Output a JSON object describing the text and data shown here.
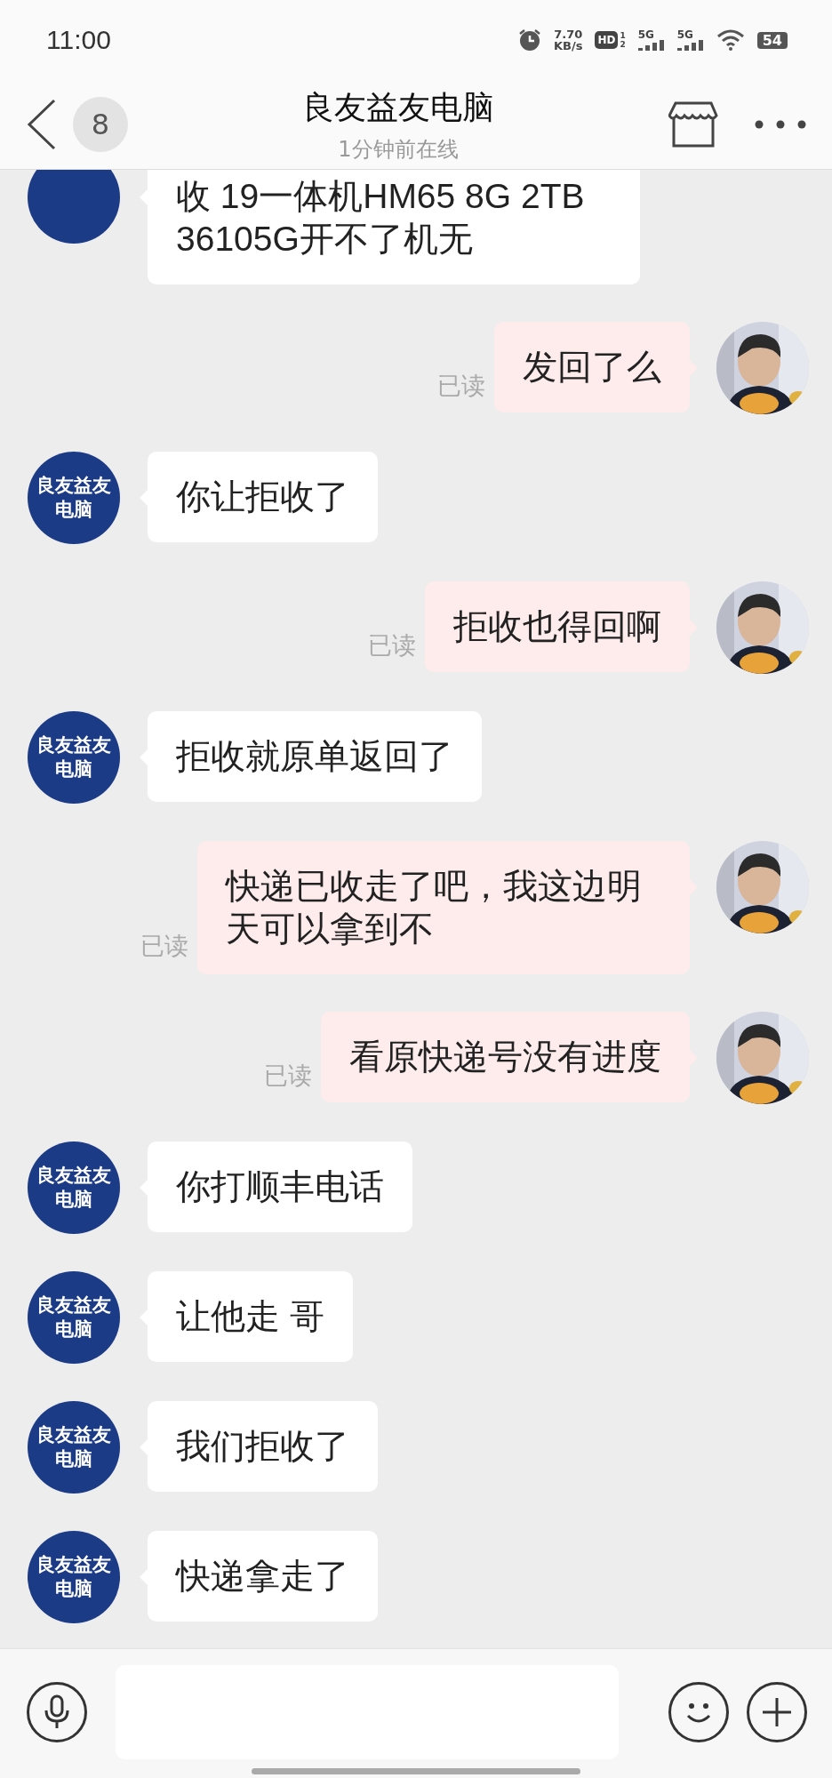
{
  "status_bar": {
    "time": "11:00",
    "speed_value": "7.70",
    "speed_unit": "KB/s",
    "hd_label": "HD",
    "hd_sub": "1\n2",
    "network_1": "5G",
    "network_2": "5G",
    "battery": "54"
  },
  "header": {
    "unread_count": "8",
    "title": "良友益友电脑",
    "subtitle": "1分钟前在线"
  },
  "messages": [
    {
      "kind": "incoming",
      "text": "收 19一体机HM65 8G 2TB 36105G开不了机无"
    },
    {
      "kind": "outgoing",
      "text": "发回了么",
      "receipt": "已读"
    },
    {
      "kind": "incoming",
      "avatar_lines": [
        "良友益友",
        "电脑"
      ],
      "text": "你让拒收了"
    },
    {
      "kind": "outgoing",
      "text": "拒收也得回啊",
      "receipt": "已读"
    },
    {
      "kind": "incoming",
      "avatar_lines": [
        "良友益友",
        "电脑"
      ],
      "text": "拒收就原单返回了"
    },
    {
      "kind": "outgoing",
      "text": "快递已收走了吧，我这边明天可以拿到不",
      "receipt": "已读"
    },
    {
      "kind": "outgoing",
      "text": "看原快递号没有进度",
      "receipt": "已读"
    },
    {
      "kind": "incoming",
      "avatar_lines": [
        "良友益友",
        "电脑"
      ],
      "text": "你打顺丰电话"
    },
    {
      "kind": "incoming",
      "avatar_lines": [
        "良友益友",
        "电脑"
      ],
      "text": "让他走 哥"
    },
    {
      "kind": "incoming",
      "avatar_lines": [
        "良友益友",
        "电脑"
      ],
      "text": "我们拒收了"
    },
    {
      "kind": "incoming",
      "avatar_lines": [
        "良友益友",
        "电脑"
      ],
      "text": "快递拿走了"
    }
  ]
}
